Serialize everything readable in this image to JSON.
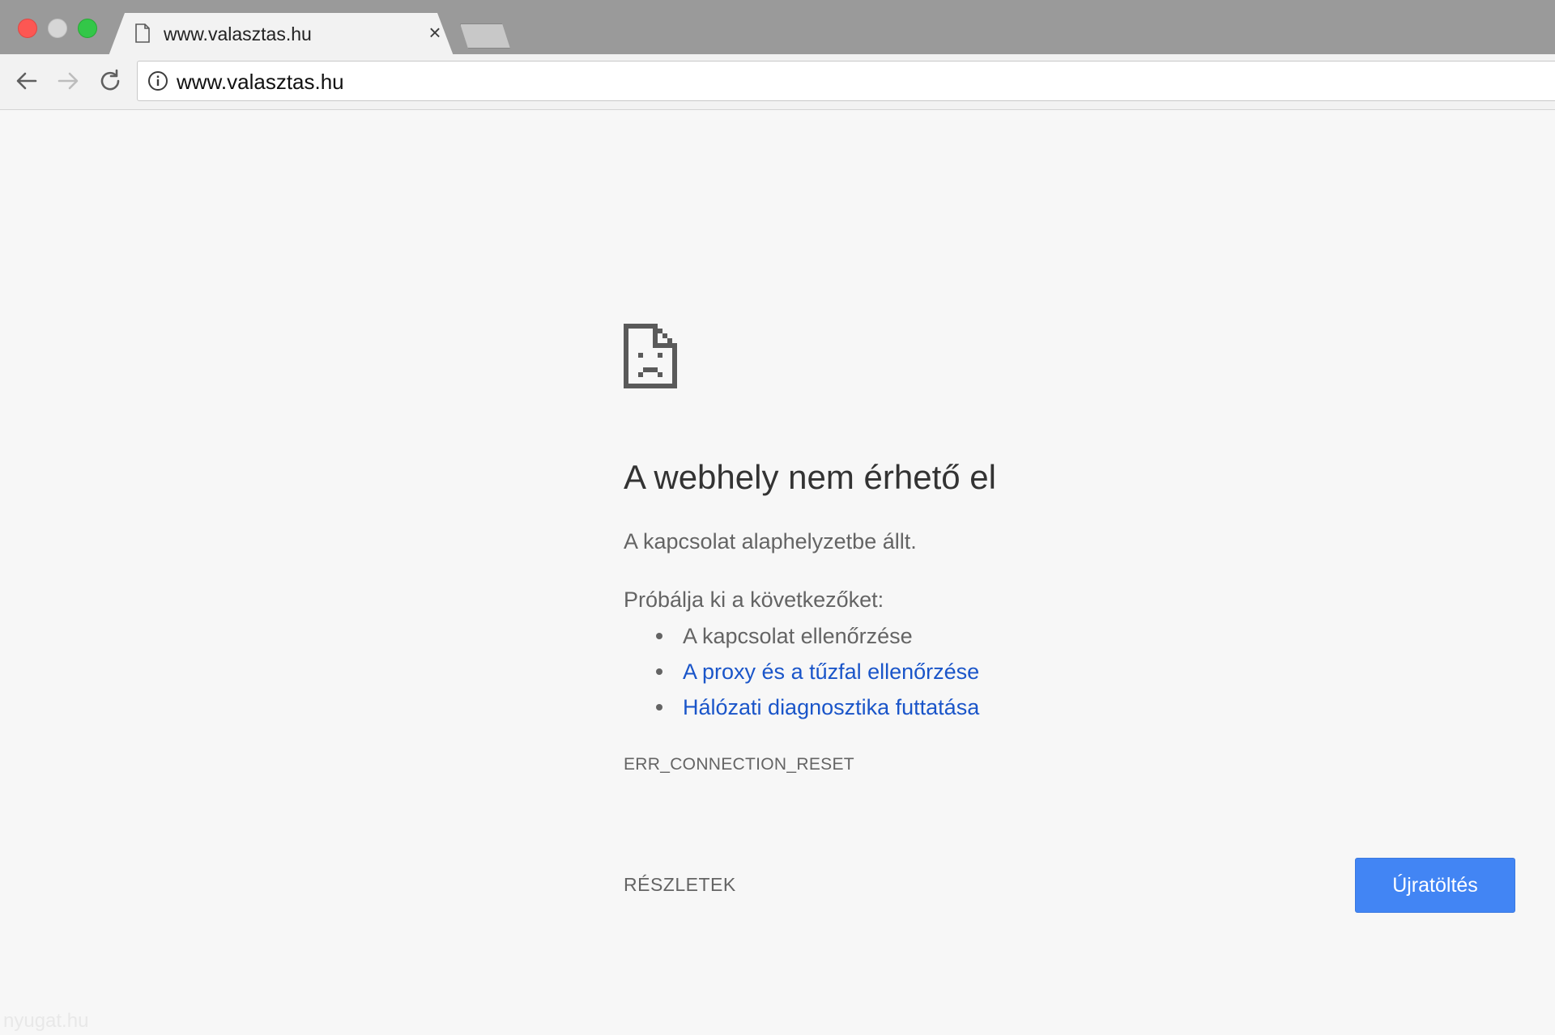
{
  "window": {
    "controls": [
      "close",
      "minimize",
      "maximize"
    ]
  },
  "tab": {
    "title": "www.valasztas.hu",
    "icon": "page-icon",
    "close_glyph": "×"
  },
  "toolbar": {
    "back_icon": "back-arrow-icon",
    "forward_icon": "forward-arrow-icon",
    "reload_icon": "reload-icon",
    "url": "www.valasztas.hu",
    "security_icon": "info-icon"
  },
  "error_page": {
    "icon": "sad-page-icon",
    "heading": "A webhely nem érhető el",
    "subtitle": "A kapcsolat alaphelyzetbe állt.",
    "suggestions_title": "Próbálja ki a következőket:",
    "suggestions": [
      {
        "text": "A kapcsolat ellenőrzése",
        "is_link": false
      },
      {
        "text": "A proxy és a tűzfal ellenőrzése",
        "is_link": true
      },
      {
        "text": "Hálózati diagnosztika futtatása",
        "is_link": true
      }
    ],
    "error_code": "ERR_CONNECTION_RESET",
    "details_label": "RÉSZLETEK",
    "reload_label": "Újratöltés"
  },
  "watermark": "nyugat.hu",
  "colors": {
    "accent": "#4285f4",
    "link": "#1a55c9",
    "text": "#646464",
    "heading": "#333333",
    "background": "#f7f7f7"
  }
}
